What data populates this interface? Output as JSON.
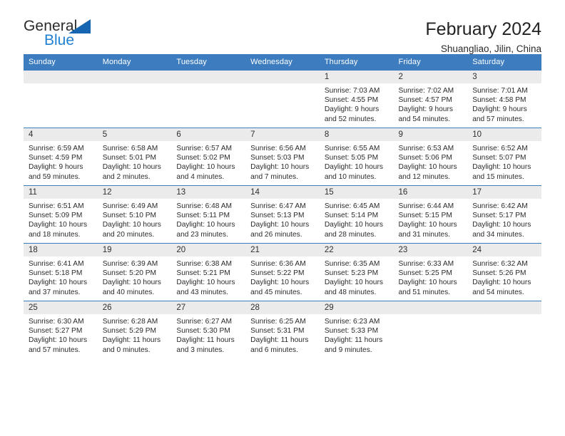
{
  "brand": {
    "name_top": "General",
    "name_bottom": "Blue",
    "accent_color": "#1f7fd0",
    "triangle_color": "#1565b0"
  },
  "header": {
    "title": "February 2024",
    "location": "Shuangliao, Jilin, China",
    "header_bg": "#3c7cbf",
    "daynum_bg": "#ebebeb"
  },
  "weekdays": [
    "Sunday",
    "Monday",
    "Tuesday",
    "Wednesday",
    "Thursday",
    "Friday",
    "Saturday"
  ],
  "labels": {
    "sunrise_prefix": "Sunrise: ",
    "sunset_prefix": "Sunset: ",
    "daylight_prefix": "Daylight: "
  },
  "weeks": [
    [
      {
        "day": "",
        "empty": true
      },
      {
        "day": "",
        "empty": true
      },
      {
        "day": "",
        "empty": true
      },
      {
        "day": "",
        "empty": true
      },
      {
        "day": "1",
        "sunrise": "Sunrise: 7:03 AM",
        "sunset": "Sunset: 4:55 PM",
        "daylight_1": "Daylight: 9 hours",
        "daylight_2": "and 52 minutes."
      },
      {
        "day": "2",
        "sunrise": "Sunrise: 7:02 AM",
        "sunset": "Sunset: 4:57 PM",
        "daylight_1": "Daylight: 9 hours",
        "daylight_2": "and 54 minutes."
      },
      {
        "day": "3",
        "sunrise": "Sunrise: 7:01 AM",
        "sunset": "Sunset: 4:58 PM",
        "daylight_1": "Daylight: 9 hours",
        "daylight_2": "and 57 minutes."
      }
    ],
    [
      {
        "day": "4",
        "sunrise": "Sunrise: 6:59 AM",
        "sunset": "Sunset: 4:59 PM",
        "daylight_1": "Daylight: 9 hours",
        "daylight_2": "and 59 minutes."
      },
      {
        "day": "5",
        "sunrise": "Sunrise: 6:58 AM",
        "sunset": "Sunset: 5:01 PM",
        "daylight_1": "Daylight: 10 hours",
        "daylight_2": "and 2 minutes."
      },
      {
        "day": "6",
        "sunrise": "Sunrise: 6:57 AM",
        "sunset": "Sunset: 5:02 PM",
        "daylight_1": "Daylight: 10 hours",
        "daylight_2": "and 4 minutes."
      },
      {
        "day": "7",
        "sunrise": "Sunrise: 6:56 AM",
        "sunset": "Sunset: 5:03 PM",
        "daylight_1": "Daylight: 10 hours",
        "daylight_2": "and 7 minutes."
      },
      {
        "day": "8",
        "sunrise": "Sunrise: 6:55 AM",
        "sunset": "Sunset: 5:05 PM",
        "daylight_1": "Daylight: 10 hours",
        "daylight_2": "and 10 minutes."
      },
      {
        "day": "9",
        "sunrise": "Sunrise: 6:53 AM",
        "sunset": "Sunset: 5:06 PM",
        "daylight_1": "Daylight: 10 hours",
        "daylight_2": "and 12 minutes."
      },
      {
        "day": "10",
        "sunrise": "Sunrise: 6:52 AM",
        "sunset": "Sunset: 5:07 PM",
        "daylight_1": "Daylight: 10 hours",
        "daylight_2": "and 15 minutes."
      }
    ],
    [
      {
        "day": "11",
        "sunrise": "Sunrise: 6:51 AM",
        "sunset": "Sunset: 5:09 PM",
        "daylight_1": "Daylight: 10 hours",
        "daylight_2": "and 18 minutes."
      },
      {
        "day": "12",
        "sunrise": "Sunrise: 6:49 AM",
        "sunset": "Sunset: 5:10 PM",
        "daylight_1": "Daylight: 10 hours",
        "daylight_2": "and 20 minutes."
      },
      {
        "day": "13",
        "sunrise": "Sunrise: 6:48 AM",
        "sunset": "Sunset: 5:11 PM",
        "daylight_1": "Daylight: 10 hours",
        "daylight_2": "and 23 minutes."
      },
      {
        "day": "14",
        "sunrise": "Sunrise: 6:47 AM",
        "sunset": "Sunset: 5:13 PM",
        "daylight_1": "Daylight: 10 hours",
        "daylight_2": "and 26 minutes."
      },
      {
        "day": "15",
        "sunrise": "Sunrise: 6:45 AM",
        "sunset": "Sunset: 5:14 PM",
        "daylight_1": "Daylight: 10 hours",
        "daylight_2": "and 28 minutes."
      },
      {
        "day": "16",
        "sunrise": "Sunrise: 6:44 AM",
        "sunset": "Sunset: 5:15 PM",
        "daylight_1": "Daylight: 10 hours",
        "daylight_2": "and 31 minutes."
      },
      {
        "day": "17",
        "sunrise": "Sunrise: 6:42 AM",
        "sunset": "Sunset: 5:17 PM",
        "daylight_1": "Daylight: 10 hours",
        "daylight_2": "and 34 minutes."
      }
    ],
    [
      {
        "day": "18",
        "sunrise": "Sunrise: 6:41 AM",
        "sunset": "Sunset: 5:18 PM",
        "daylight_1": "Daylight: 10 hours",
        "daylight_2": "and 37 minutes."
      },
      {
        "day": "19",
        "sunrise": "Sunrise: 6:39 AM",
        "sunset": "Sunset: 5:20 PM",
        "daylight_1": "Daylight: 10 hours",
        "daylight_2": "and 40 minutes."
      },
      {
        "day": "20",
        "sunrise": "Sunrise: 6:38 AM",
        "sunset": "Sunset: 5:21 PM",
        "daylight_1": "Daylight: 10 hours",
        "daylight_2": "and 43 minutes."
      },
      {
        "day": "21",
        "sunrise": "Sunrise: 6:36 AM",
        "sunset": "Sunset: 5:22 PM",
        "daylight_1": "Daylight: 10 hours",
        "daylight_2": "and 45 minutes."
      },
      {
        "day": "22",
        "sunrise": "Sunrise: 6:35 AM",
        "sunset": "Sunset: 5:23 PM",
        "daylight_1": "Daylight: 10 hours",
        "daylight_2": "and 48 minutes."
      },
      {
        "day": "23",
        "sunrise": "Sunrise: 6:33 AM",
        "sunset": "Sunset: 5:25 PM",
        "daylight_1": "Daylight: 10 hours",
        "daylight_2": "and 51 minutes."
      },
      {
        "day": "24",
        "sunrise": "Sunrise: 6:32 AM",
        "sunset": "Sunset: 5:26 PM",
        "daylight_1": "Daylight: 10 hours",
        "daylight_2": "and 54 minutes."
      }
    ],
    [
      {
        "day": "25",
        "sunrise": "Sunrise: 6:30 AM",
        "sunset": "Sunset: 5:27 PM",
        "daylight_1": "Daylight: 10 hours",
        "daylight_2": "and 57 minutes."
      },
      {
        "day": "26",
        "sunrise": "Sunrise: 6:28 AM",
        "sunset": "Sunset: 5:29 PM",
        "daylight_1": "Daylight: 11 hours",
        "daylight_2": "and 0 minutes."
      },
      {
        "day": "27",
        "sunrise": "Sunrise: 6:27 AM",
        "sunset": "Sunset: 5:30 PM",
        "daylight_1": "Daylight: 11 hours",
        "daylight_2": "and 3 minutes."
      },
      {
        "day": "28",
        "sunrise": "Sunrise: 6:25 AM",
        "sunset": "Sunset: 5:31 PM",
        "daylight_1": "Daylight: 11 hours",
        "daylight_2": "and 6 minutes."
      },
      {
        "day": "29",
        "sunrise": "Sunrise: 6:23 AM",
        "sunset": "Sunset: 5:33 PM",
        "daylight_1": "Daylight: 11 hours",
        "daylight_2": "and 9 minutes."
      },
      {
        "day": "",
        "empty": true
      },
      {
        "day": "",
        "empty": true
      }
    ]
  ]
}
